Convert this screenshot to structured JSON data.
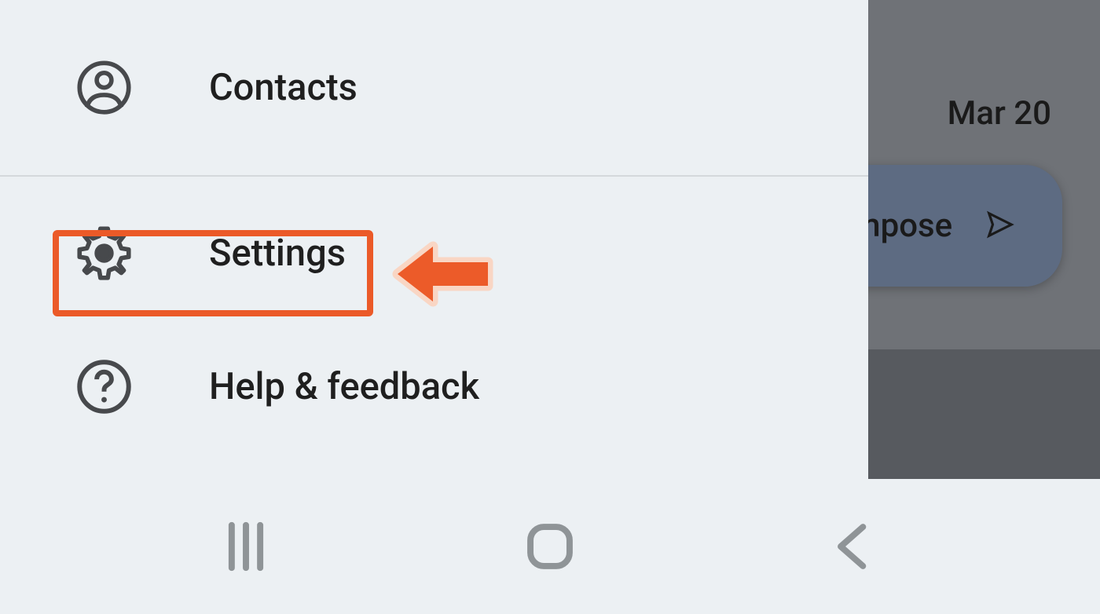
{
  "sidebar": {
    "items": [
      {
        "label": "Contacts",
        "icon": "person-icon"
      },
      {
        "label": "Settings",
        "icon": "gear-icon"
      },
      {
        "label": "Help & feedback",
        "icon": "help-icon"
      }
    ]
  },
  "background": {
    "date_label": "Mar 20",
    "compose_partial_label": "mpose"
  },
  "navbar": {
    "recents": "recents-icon",
    "home": "home-icon",
    "back": "back-icon"
  },
  "annotation": {
    "highlighted_item": "Settings"
  }
}
